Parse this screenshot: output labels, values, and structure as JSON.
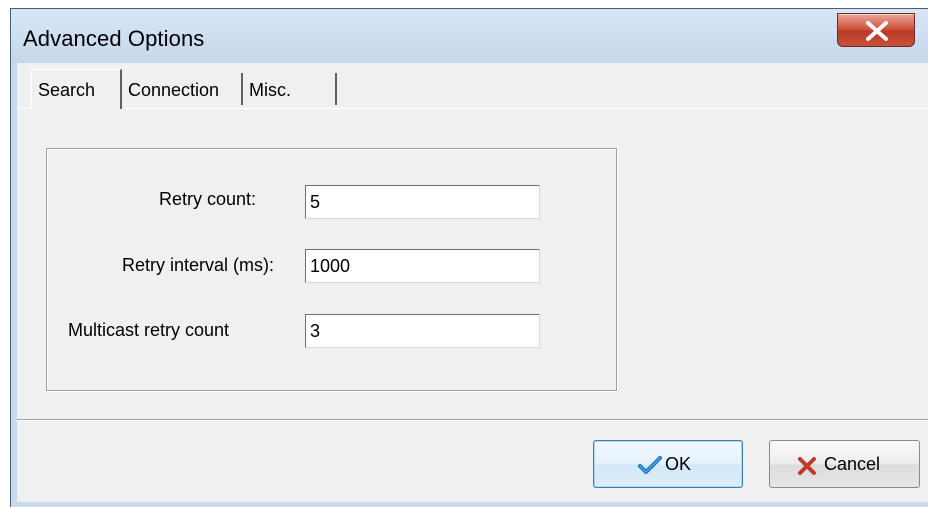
{
  "window": {
    "title": "Advanced Options"
  },
  "tabs": [
    {
      "label": "Search",
      "active": true
    },
    {
      "label": "Connection",
      "active": false
    },
    {
      "label": "Misc.",
      "active": false
    }
  ],
  "search": {
    "retry_count_label": "Retry count:",
    "retry_count_value": "5",
    "retry_interval_label": "Retry interval (ms):",
    "retry_interval_value": "1000",
    "multicast_retry_label": "Multicast retry count",
    "multicast_retry_value": "3"
  },
  "buttons": {
    "ok_label": "OK",
    "cancel_label": "Cancel"
  },
  "icons": {
    "close": "close-icon",
    "ok": "checkmark-icon",
    "cancel": "x-mark-icon"
  },
  "colors": {
    "close_button": "#c8513a",
    "ok_check": "#1f6fbf",
    "cancel_x": "#c0392b"
  }
}
